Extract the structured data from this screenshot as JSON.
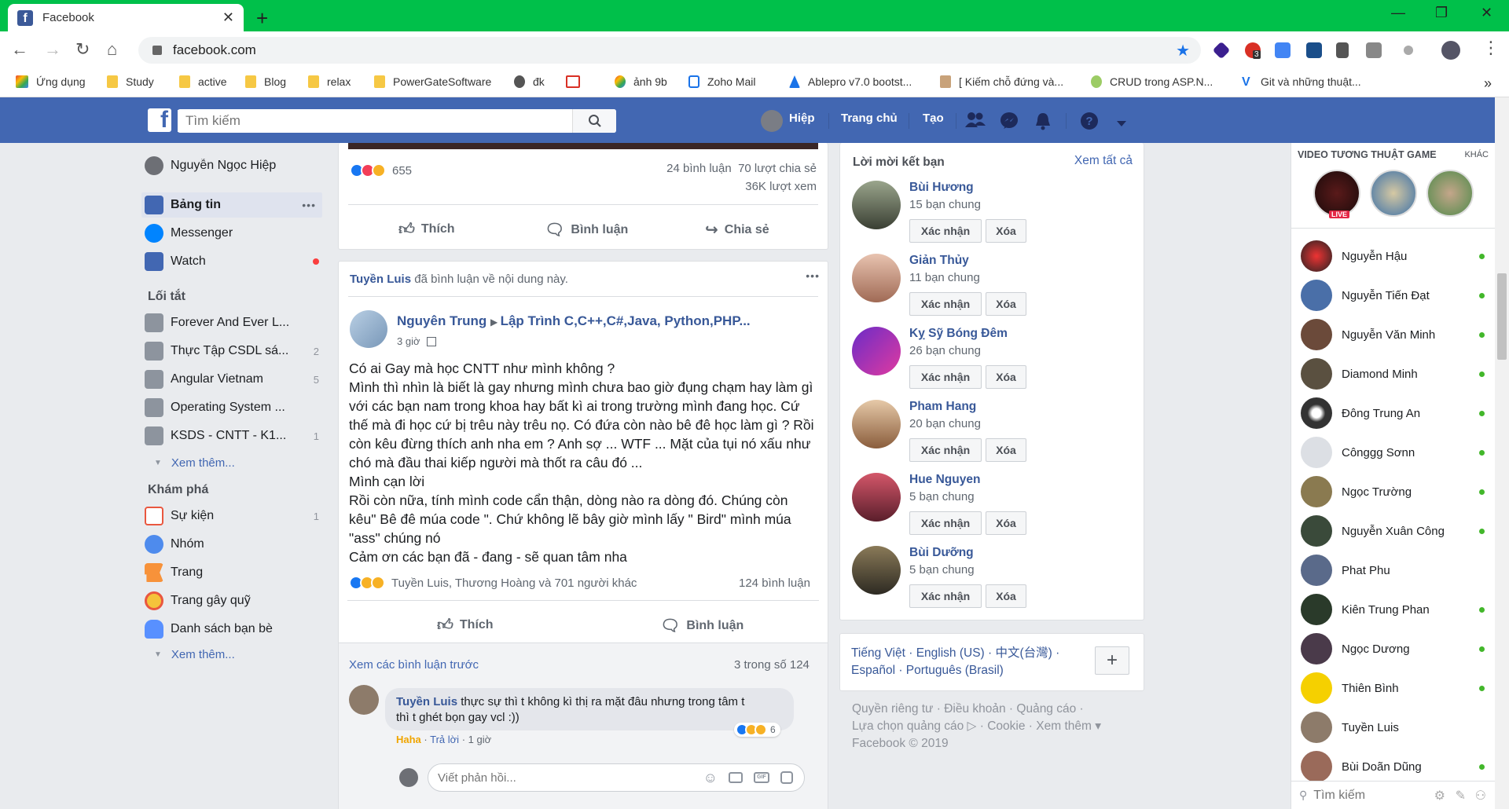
{
  "browser": {
    "tab_title": "Facebook",
    "tab_close": "✕",
    "new_tab": "+",
    "url": "facebook.com",
    "ext_badge": "3",
    "bookmarks": [
      "Ứng dụng",
      "Study",
      "active",
      "Blog",
      "relax",
      "PowerGateSoftware",
      "đk",
      "ảnh 9b",
      "Zoho Mail",
      "Ablepro v7.0 bootst...",
      "[ Kiếm chỗ đứng và...",
      "CRUD trong ASP.N...",
      "Git và những thuật..."
    ],
    "more": "»"
  },
  "fb_header": {
    "search_placeholder": "Tìm kiếm",
    "user": "Hiệp",
    "home": "Trang chủ",
    "create": "Tạo"
  },
  "left_nav": {
    "profile": "Nguyễn Ngọc Hiệp",
    "news_feed": "Bảng tin",
    "news_feed_more": "•••",
    "messenger": "Messenger",
    "watch": "Watch",
    "shortcuts_title": "Lối tắt",
    "shortcuts": [
      {
        "label": "Forever And Ever L...",
        "count": ""
      },
      {
        "label": "Thực Tập CSDL sá...",
        "count": "2"
      },
      {
        "label": "Angular Vietnam",
        "count": "5"
      },
      {
        "label": "Operating System ...",
        "count": ""
      },
      {
        "label": "KSDS - CNTT - K1...",
        "count": "1"
      }
    ],
    "see_more": "Xem thêm...",
    "explore_title": "Khám phá",
    "explore": [
      {
        "label": "Sự kiện",
        "count": "1"
      },
      {
        "label": "Nhóm",
        "count": ""
      },
      {
        "label": "Trang",
        "count": ""
      },
      {
        "label": "Trang gây quỹ",
        "count": ""
      },
      {
        "label": "Danh sách bạn bè",
        "count": ""
      }
    ],
    "see_more2": "Xem thêm..."
  },
  "post1": {
    "reactions": "655",
    "comments": "24 bình luận",
    "shares": "70 lượt chia sẻ",
    "views": "36K lượt xem",
    "like": "Thích",
    "comment": "Bình luận",
    "share": "Chia sẻ"
  },
  "post2": {
    "activity_user": "Tuyền Luis",
    "activity_text": "đã bình luận về nội dung này.",
    "more": "•••",
    "author": "Nguyên Trung",
    "group": "Lập Trình C,C++,C#,Java, Python,PHP...",
    "time": "3 giờ",
    "text_lines": [
      "Có ai Gay mà học CNTT như mình không ?",
      "Mình thì nhìn là biết là gay nhưng mình chưa bao giờ đụng chạm hay làm gì",
      "với các bạn nam trong khoa hay bất kì ai trong trường mình đang học. Cứ",
      "thế mà đi học cứ bị trêu này trêu nọ. Có đứa còn nào bê đê học làm gì ? Rồi",
      "còn kêu đừng thích anh nha em ? Anh sợ ... WTF ... Mặt của tụi nó xấu như",
      "chó mà đầu thai kiếp người mà thốt ra câu đó ...",
      "Mình cạn lời",
      "Rồi còn nữa, tính mình code cẩn thận, dòng nào ra dòng đó. Chúng còn",
      "kêu\" Bê đê múa code \". Chứ không lẽ bây giờ mình lấy \" Bird\" mình múa",
      "\"ass\" chúng nó",
      "Cảm ơn các bạn đã - đang - sẽ quan tâm nha"
    ],
    "reactors": "Tuyền Luis, Thương Hoàng và 701 người khác",
    "comments": "124 bình luận",
    "like": "Thích",
    "comment": "Bình luận",
    "prev_comments": "Xem các bình luận trước",
    "comment_count": "3 trong số 124",
    "c_user": "Tuyền Luis",
    "c_text1": "thực sự thì t không kì thị ra mặt đâu nhưng trong tâm t",
    "c_text2": "thì t ghét bọn gay vcl :))",
    "c_haha": "Haha",
    "c_reply": "Trả lời",
    "c_time": "1 giờ",
    "c_reacts": "6",
    "reply_placeholder": "Viết phản hồi..."
  },
  "friend_requests": {
    "title": "Lời mời kết bạn",
    "see_all": "Xem tất cả",
    "confirm": "Xác nhận",
    "delete": "Xóa",
    "items": [
      {
        "name": "Bùi Hương",
        "mutual": "15 bạn chung"
      },
      {
        "name": "Giản Thủy",
        "mutual": "11 bạn chung"
      },
      {
        "name": "Kỵ Sỹ Bóng Đêm",
        "mutual": "26 bạn chung"
      },
      {
        "name": "Pham Hang",
        "mutual": "20 bạn chung"
      },
      {
        "name": "Hue Nguyen",
        "mutual": "5 bạn chung"
      },
      {
        "name": "Bùi Dưỡng",
        "mutual": "5 bạn chung"
      }
    ]
  },
  "languages": {
    "line1": "Tiếng Việt · English (US) · 中文(台灣) ·",
    "line2": "Español · Português (Brasil)",
    "plus": "+"
  },
  "footer": {
    "line1": "Quyền riêng tư · Điều khoản · Quảng cáo ·",
    "line2": "Lựa chọn quảng cáo ▷ · Cookie · Xem thêm ▾",
    "line3": "Facebook © 2019"
  },
  "chat": {
    "video_title": "VIDEO TƯƠNG THUẬT GAME",
    "video_more": "KHÁC",
    "live": "LIVE",
    "contacts": [
      "Nguyễn Hậu",
      "Nguyễn Tiến Đạt",
      "Nguyễn Văn Minh",
      "Diamond Minh",
      "Đông Trung An",
      "Cônggg Sơnn",
      "Ngọc Trường",
      "Nguyễn Xuân Công",
      "Phat Phu",
      "Kiên Trung Phan",
      "Ngọc Dương",
      "Thiên Bình",
      "Tuyền Luis",
      "Bùi Doãn Dũng"
    ],
    "search_placeholder": "Tìm kiếm"
  },
  "colors": {
    "chrome_green": "#00c04a",
    "fb_blue": "#4267b2",
    "link": "#385898",
    "online": "#42b72a"
  }
}
